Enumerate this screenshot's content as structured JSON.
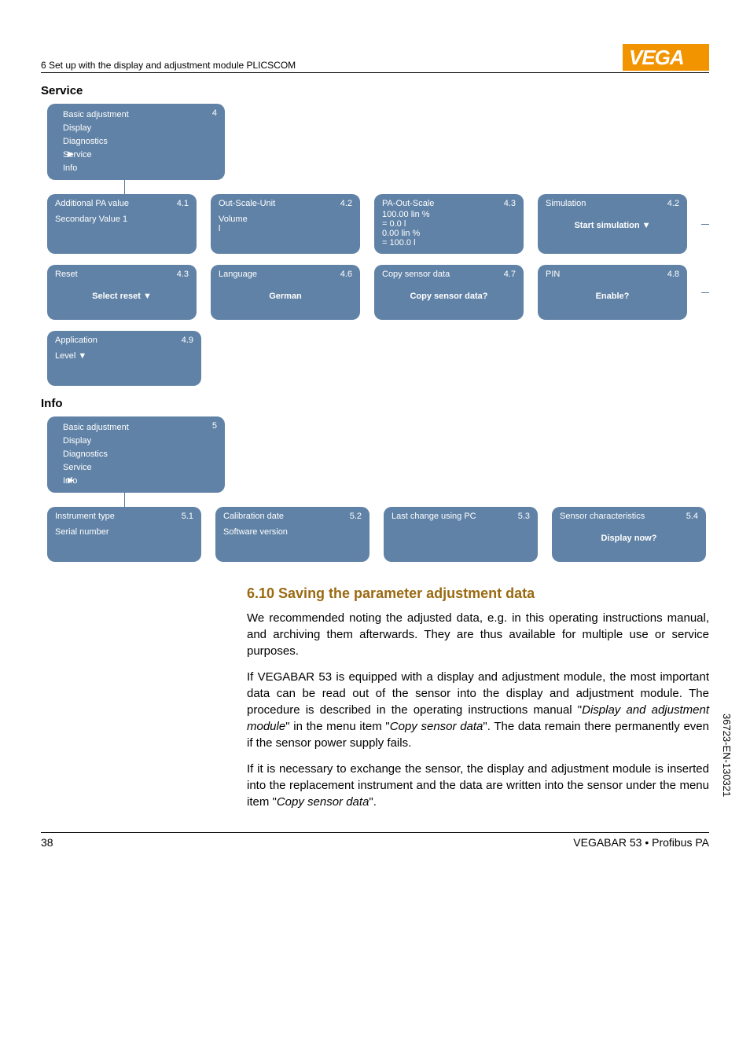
{
  "header": {
    "breadcrumb": "6 Set up with the display and adjustment module PLICSCOM"
  },
  "sections": {
    "service_title": "Service",
    "info_title": "Info"
  },
  "menu_service": {
    "idx": "4",
    "items": [
      "Basic adjustment",
      "Display",
      "Diagnostics",
      "Service",
      "Info"
    ],
    "selected_index": 3
  },
  "menu_info": {
    "idx": "5",
    "items": [
      "Basic adjustment",
      "Display",
      "Diagnostics",
      "Service",
      "Info"
    ],
    "selected_index": 4
  },
  "service_rows": [
    [
      {
        "idx": "4.1",
        "title": "Additional PA value",
        "lines": [
          "",
          "Secondary Value 1"
        ]
      },
      {
        "idx": "4.2",
        "title": "Out-Scale-Unit",
        "lines": [
          "",
          "Volume",
          "l"
        ]
      },
      {
        "idx": "4.3",
        "title": "PA-Out-Scale",
        "lines": [
          "100.00 lin %",
          "= 0.0 l",
          "0.00 lin %",
          "= 100.0 l"
        ]
      },
      {
        "idx": "4.2",
        "title": "Simulation",
        "bold": "Start simulation ▼"
      }
    ],
    [
      {
        "idx": "4.3",
        "title": "Reset",
        "bold": "Select reset ▼"
      },
      {
        "idx": "4.6",
        "title": "Language",
        "bold": "German"
      },
      {
        "idx": "4.7",
        "title": "Copy sensor data",
        "bold": "Copy sensor data?"
      },
      {
        "idx": "4.8",
        "title": "PIN",
        "bold": "Enable?"
      }
    ],
    [
      {
        "idx": "4.9",
        "title": "Application",
        "lines": [
          "",
          "Level ▼"
        ]
      }
    ]
  ],
  "info_row": [
    {
      "idx": "5.1",
      "title": "Instrument type",
      "lines": [
        "",
        "",
        "Serial number"
      ]
    },
    {
      "idx": "5.2",
      "title": "Calibration date",
      "lines": [
        "",
        "Software version"
      ]
    },
    {
      "idx": "5.3",
      "title": "Last change using PC",
      "lines": [
        ""
      ]
    },
    {
      "idx": "5.4",
      "title": "Sensor characteristics",
      "bold": "Display now?"
    }
  ],
  "body": {
    "heading": "6.10  Saving the parameter adjustment data",
    "p1": "We recommended noting the adjusted data, e.g. in this operating instructions manual, and archiving them afterwards. They are thus available for multiple use or service purposes.",
    "p2_a": "If VEGABAR 53 is equipped with a display and adjustment module, the most important data can be read out of the sensor into the display and adjustment module. The procedure is described in the operating instructions manual \"",
    "p2_i1": "Display and adjustment module",
    "p2_b": "\" in the menu item \"",
    "p2_i2": "Copy sensor data",
    "p2_c": "\". The data remain there permanently even if the sensor power supply fails.",
    "p3_a": "If it is necessary to exchange the sensor, the display and adjustment module is inserted into the replacement instrument and the data are written into the sensor under the menu item \"",
    "p3_i1": "Copy sensor data",
    "p3_b": "\"."
  },
  "footer": {
    "page": "38",
    "product": "VEGABAR 53 • Profibus PA"
  },
  "side_code": "36723-EN-130321"
}
